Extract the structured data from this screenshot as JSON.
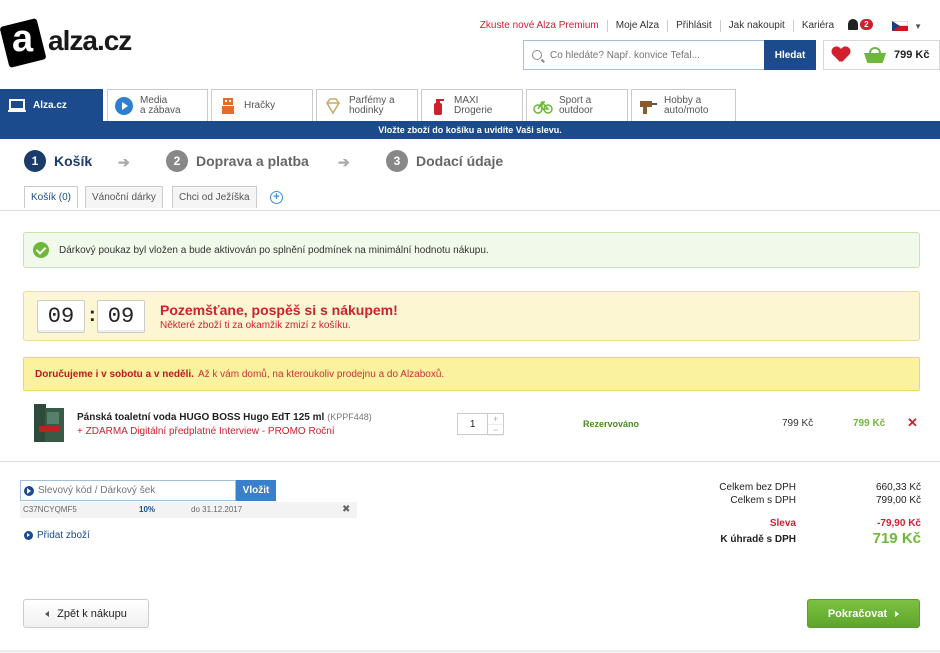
{
  "header": {
    "logo_letter": "a",
    "logo_name": "alza",
    "logo_tld": ".cz",
    "top_links": [
      "Zkuste nové Alza Premium",
      "Moje Alza",
      "Přihlásit",
      "Jak nakoupit",
      "Kariéra"
    ],
    "notification_count": "2",
    "search_placeholder": "Co hledáte? Např. konvice Tefal...",
    "search_button": "Hledat",
    "cart_total": "799 Kč"
  },
  "category_tabs": [
    {
      "label": "Alza.cz",
      "icon": "laptop-icon"
    },
    {
      "label": "Media\na zábava",
      "icon": "play-icon"
    },
    {
      "label": "Hračky",
      "icon": "robot-icon"
    },
    {
      "label": "Parfémy a\nhodinky",
      "icon": "diamond-icon"
    },
    {
      "label": "MAXI\nDrogerie",
      "icon": "spray-bottle-icon"
    },
    {
      "label": "Sport a\noutdoor",
      "icon": "bicycle-icon"
    },
    {
      "label": "Hobby a\nauto/moto",
      "icon": "drill-icon"
    }
  ],
  "promo_bar": "Vložte zboží do košíku a uvidíte Vaši slevu.",
  "steps": [
    {
      "num": "1",
      "label": "Košík"
    },
    {
      "num": "2",
      "label": "Doprava a platba"
    },
    {
      "num": "3",
      "label": "Dodací údaje"
    }
  ],
  "cart_tabs": [
    "Košík (0)",
    "Vánoční dárky",
    "Chci od Ježíška"
  ],
  "alerts": {
    "voucher": "Dárkový poukaz byl vložen a bude aktivován po splnění podmínek na minimální hodnotu nákupu.",
    "timer_minutes": "09",
    "timer_seconds": "09",
    "timer_colon": ":",
    "timer_title": "Pozemšťane, pospěš si s nákupem!",
    "timer_sub": "Některé zboží ti za okamžik zmizí z košíku.",
    "delivery_bold": "Doručujeme i v sobotu a v neděli.",
    "delivery_text": "Až k vám domů, na kteroukoliv prodejnu a do Alzaboxů."
  },
  "product": {
    "name": "Pánská toaletní voda HUGO BOSS Hugo EdT 125 ml",
    "code": "(KPPF448)",
    "gift": "+ ZDARMA Digitální předplatné Interview - PROMO Roční",
    "quantity": "1",
    "status": "Rezervováno",
    "unit_price": "799 Kč",
    "total_price": "799 Kč"
  },
  "coupon": {
    "placeholder": "Slevový kód / Dárkový šek",
    "button": "Vložit",
    "code": "C37NCYQMF5",
    "discount": "10%",
    "valid": "do 31.12.2017",
    "add_item": "Přidat zboží"
  },
  "summary": {
    "without_vat_label": "Celkem bez DPH",
    "without_vat_value": "660,33 Kč",
    "with_vat_label": "Celkem s DPH",
    "with_vat_value": "799,00 Kč",
    "discount_label": "Sleva",
    "discount_value": "-79,90 Kč",
    "to_pay_label": "K úhradě s DPH",
    "to_pay_value": "719 Kč"
  },
  "buttons": {
    "back": "Zpět k nákupu",
    "continue": "Pokračovat"
  },
  "colors": {
    "brand_blue": "#1b4b8c",
    "accent_red": "#d0202e",
    "accent_green": "#6db83a"
  }
}
